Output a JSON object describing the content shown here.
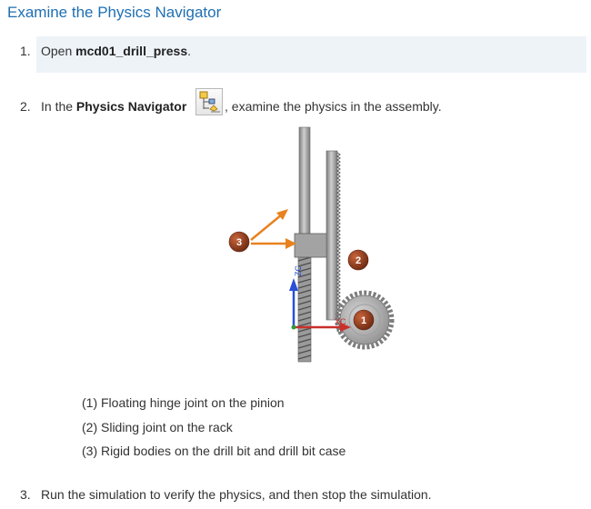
{
  "title": "Examine the Physics Navigator",
  "steps": [
    {
      "number": "1.",
      "prefix": "Open ",
      "bold": "mcd01_drill_press",
      "suffix": "."
    },
    {
      "number": "2.",
      "prefix": "In the ",
      "bold": "Physics Navigator",
      "suffix": ", examine the physics in the assembly."
    },
    {
      "number": "3.",
      "text": "Run the simulation to verify the physics, and then stop the simulation."
    }
  ],
  "figure": {
    "callouts": [
      "1",
      "2",
      "3"
    ],
    "axis_labels": {
      "z": "ZC",
      "x": "XC"
    },
    "colors": {
      "callout_fill": "#8b3a1c",
      "arrow": "#e8821e",
      "metal": "#9a9a9a",
      "z_axis": "#2a4fd6",
      "x_axis": "#c8302c"
    }
  },
  "captions": [
    "(1) Floating hinge joint on the pinion",
    "(2) Sliding joint on the rack",
    "(3) Rigid bodies on the drill bit and drill bit case"
  ],
  "icons": {
    "physics_navigator": "physics-navigator-icon"
  }
}
